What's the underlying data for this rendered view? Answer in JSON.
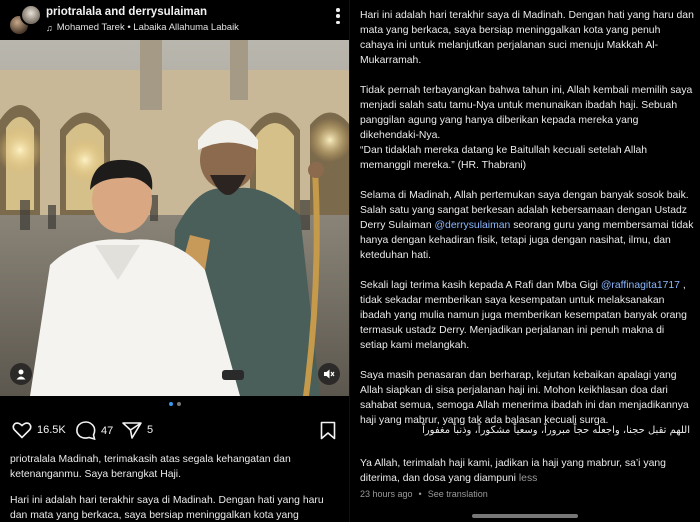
{
  "post": {
    "usernames": "priotralala and derrysulaiman",
    "audio": "Mohamed Tarek • Labaika Allahuma Labaik",
    "likes": "16.5K",
    "comments": "47",
    "shares": "5",
    "carousel": {
      "count": 2,
      "active_index": 0
    }
  },
  "caption_left": {
    "line1": "priotralala Madinah, terimakasih atas segala kehangatan dan ketenanganmu. Saya berangkat Haji.",
    "line2": "Hari ini adalah hari terakhir saya di Madinah. Dengan hati yang haru dan mata yang berkaca, saya bersiap meninggalkan kota yang"
  },
  "caption_right": {
    "p1": "Hari ini adalah hari terakhir saya di Madinah. Dengan hati yang haru dan mata yang berkaca, saya bersiap meninggalkan kota yang penuh cahaya ini untuk melanjutkan perjalanan suci menuju Makkah Al-Mukarramah.",
    "p2": "Tidak pernah terbayangkan bahwa tahun ini, Allah kembali memilih saya menjadi salah satu tamu-Nya untuk menunaikan ibadah haji. Sebuah panggilan agung yang hanya diberikan kepada mereka yang dikehendaki-Nya.",
    "p2_quote": "“Dan tidaklah mereka datang ke Baitullah kecuali setelah Allah memanggil mereka.” (HR. Thabrani)",
    "p3_a": "Selama di Madinah, Allah pertemukan saya dengan banyak sosok baik. Salah satu yang sangat berkesan adalah kebersamaan dengan Ustadz Derry Sulaiman ",
    "p3_mention": "@derrysulaiman",
    "p3_b": " seorang guru yang membersamai tidak hanya dengan kehadiran fisik, tetapi juga dengan nasihat, ilmu, dan keteduhan hati.",
    "p4_a": "Sekali lagi terima kasih kepada A Rafi dan Mba Gigi ",
    "p4_mention": "@raffinagita1717",
    "p4_b": " , tidak sekadar memberikan saya kesempatan untuk melaksanakan ibadah yang mulia namun juga memberikan kesempatan banyak orang termasuk ustadz Derry. Menjadikan perjalanan ini penuh makna di setiap kami melangkah.",
    "p5": "Saya masih penasaran dan berharap, kejutan kebaikan apalagi yang Allah siapkan di sisa perjalanan haji ini. Mohon keikhlasan doa dari sahabat semua, semoga Allah menerima ibadah ini dan menjadikannya haji yang mabrur, yang tak ada balasan kecuali surga.",
    "arabic": "اللهم تقبل حجنا، واجعله حجاً مبروراً، وسعياً مشكوراً، وذنباً مغفوراً",
    "prayer": "Ya Allah, terimalah haji kami, jadikan ia haji yang mabrur, sa’i yang diterima, dan dosa yang diampuni",
    "less": "less",
    "time_ago": "23 hours ago",
    "see_translation": "See translation"
  },
  "colors": {
    "link": "#8cb8ff",
    "dot_active": "#3897f0",
    "muted": "#9a9a9a"
  },
  "icons": [
    "more-icon",
    "heart-icon",
    "comment-icon",
    "share-icon",
    "save-icon",
    "user-tag-icon",
    "mute-icon",
    "music-icon"
  ]
}
